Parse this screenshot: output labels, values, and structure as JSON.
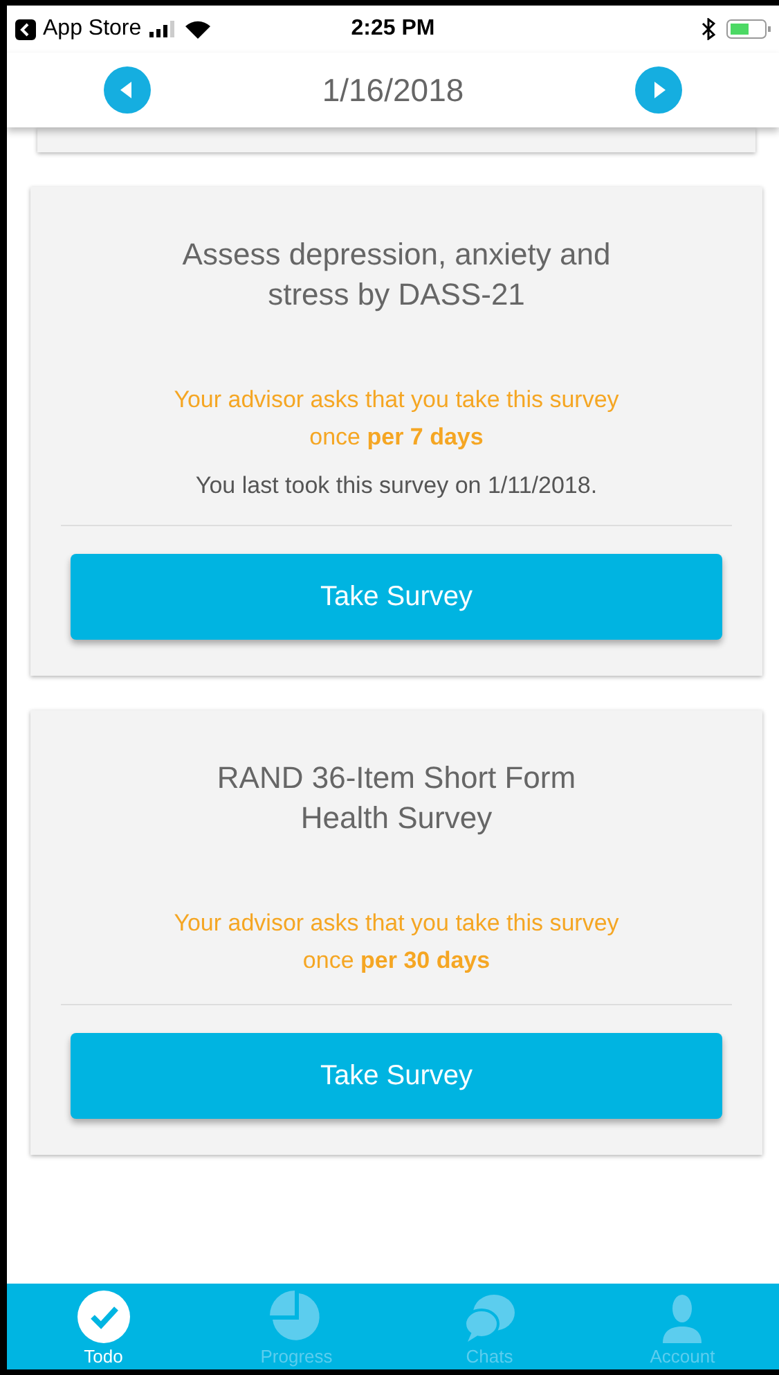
{
  "status_bar": {
    "back_label": "App Store",
    "time": "2:25 PM"
  },
  "header": {
    "date": "1/16/2018"
  },
  "surveys": [
    {
      "title": "Assess depression, anxiety and stress by DASS-21",
      "request": "Your advisor asks that you take this survey",
      "frequency": "once **per 7 days**",
      "last_taken": "You last took this survey on 1/11/2018.",
      "button": "Take Survey"
    },
    {
      "title": "RAND 36-Item Short Form Health Survey",
      "request": "Your advisor asks that you take this survey",
      "frequency": "once **per 30 days**",
      "button": "Take Survey"
    }
  ],
  "tabs": [
    {
      "kind": "todo",
      "label": "Todo",
      "selected": true
    },
    {
      "kind": "progress",
      "label": "Progress",
      "selected": false
    },
    {
      "kind": "chats",
      "label": "Chats",
      "selected": false
    },
    {
      "kind": "account",
      "label": "Account",
      "selected": false
    }
  ]
}
